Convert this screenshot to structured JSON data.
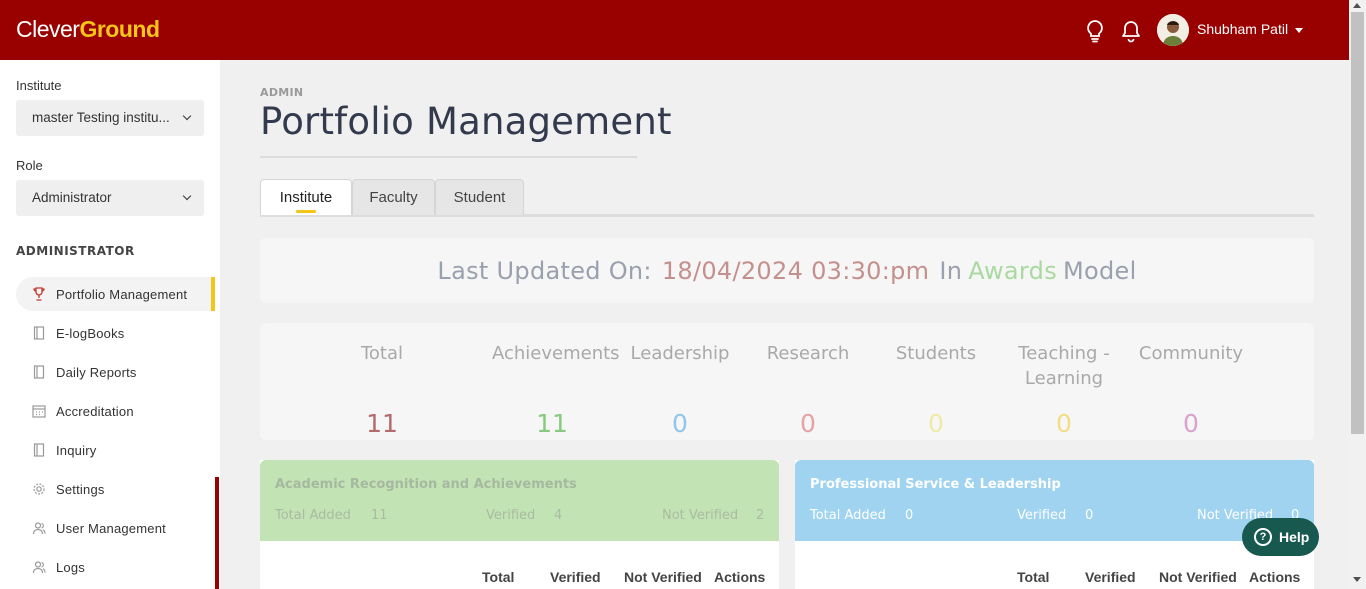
{
  "header": {
    "logo_part1": "Clever",
    "logo_part2": "Ground",
    "user_name": "Shubham Patil",
    "icons": [
      "bulb-icon",
      "bell-icon",
      "avatar",
      "caret-down-icon"
    ]
  },
  "sidebar": {
    "institute_label": "Institute",
    "institute_value": "master Testing institu...",
    "role_label": "Role",
    "role_value": "Administrator",
    "section_title": "ADMINISTRATOR",
    "items": [
      {
        "label": "Portfolio Management",
        "icon": "trophy-icon",
        "active": true
      },
      {
        "label": "E-logBooks",
        "icon": "book-icon",
        "active": false
      },
      {
        "label": "Daily Reports",
        "icon": "book-icon",
        "active": false
      },
      {
        "label": "Accreditation",
        "icon": "calendar-icon",
        "active": false
      },
      {
        "label": "Inquiry",
        "icon": "book-icon",
        "active": false
      },
      {
        "label": "Settings",
        "icon": "gear-icon",
        "active": false
      },
      {
        "label": "User Management",
        "icon": "users-icon",
        "active": false
      },
      {
        "label": "Logs",
        "icon": "users-icon",
        "active": false
      }
    ]
  },
  "main": {
    "breadcrumb": "ADMIN",
    "title": "Portfolio Management",
    "tabs": [
      {
        "label": "Institute",
        "active": true
      },
      {
        "label": "Faculty",
        "active": false
      },
      {
        "label": "Student",
        "active": false
      }
    ],
    "last_updated": {
      "prefix": "Last Updated On:",
      "date": "18/04/2024 03:30:pm",
      "in": "In",
      "model_name": "Awards",
      "suffix": "Model"
    },
    "stats": [
      {
        "label": "Total",
        "value": "11",
        "color": "#b36a6a"
      },
      {
        "label": "Achievements",
        "value": "11",
        "color": "#86c97f"
      },
      {
        "label": "Leadership",
        "value": "0",
        "color": "#8fc6ea"
      },
      {
        "label": "Research",
        "value": "0",
        "color": "#e3a3a3"
      },
      {
        "label": "Students",
        "value": "0",
        "color": "#eeeaa7"
      },
      {
        "label": "Teaching - Learning",
        "value": "0",
        "color": "#f1dd86"
      },
      {
        "label": "Community",
        "value": "0",
        "color": "#d9a1cc"
      }
    ],
    "panels": [
      {
        "title": "Academic Recognition and Achievements",
        "color": "#c2e3b3",
        "total_added_label": "Total Added",
        "total_added": "11",
        "verified_label": "Verified",
        "verified": "4",
        "not_verified_label": "Not Verified",
        "not_verified": "2",
        "columns": [
          "Total",
          "Verified",
          "Not Verified",
          "Actions"
        ]
      },
      {
        "title": "Professional Service & Leadership",
        "color": "#9fd3f0",
        "total_added_label": "Total Added",
        "total_added": "0",
        "verified_label": "Verified",
        "verified": "0",
        "not_verified_label": "Not Verified",
        "not_verified": "0",
        "columns": [
          "Total",
          "Verified",
          "Not Verified",
          "Actions"
        ]
      }
    ]
  },
  "help": {
    "label": "Help"
  }
}
